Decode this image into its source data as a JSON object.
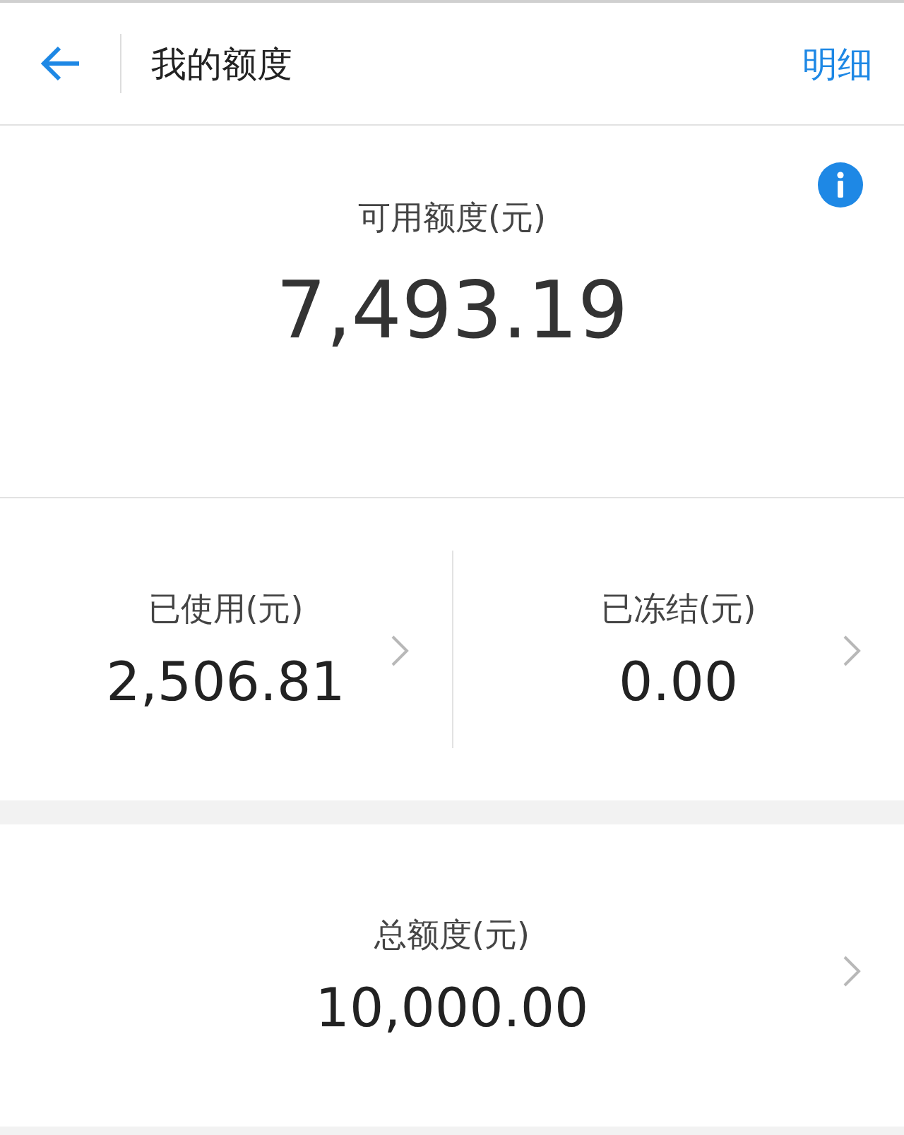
{
  "header": {
    "title": "我的额度",
    "action": "明细"
  },
  "available": {
    "label": "可用额度(元)",
    "amount": "7,493.19"
  },
  "stats": [
    {
      "label": "已使用(元)",
      "amount": "2,506.81"
    },
    {
      "label": "已冻结(元)",
      "amount": "0.00"
    }
  ],
  "total": {
    "label": "总额度(元)",
    "amount": "10,000.00"
  }
}
